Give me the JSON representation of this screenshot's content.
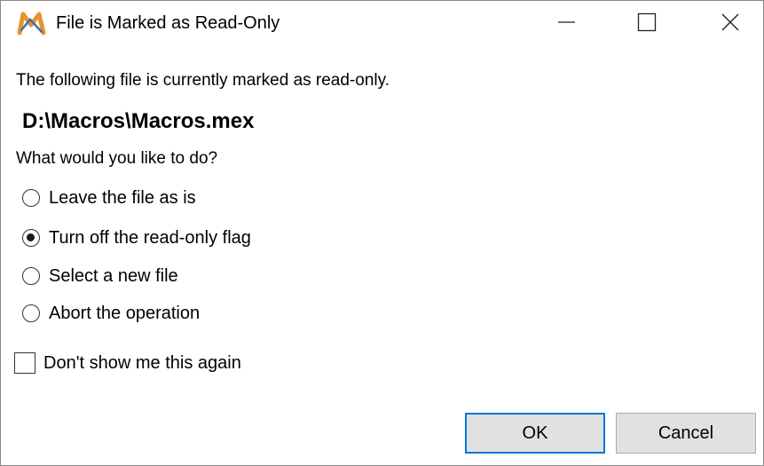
{
  "window": {
    "title": "File is Marked as Read-Only",
    "app_icon": "macro-express-m-icon",
    "controls": {
      "minimize_icon": "minimize-icon",
      "maximize_icon": "maximize-icon",
      "close_icon": "close-icon"
    }
  },
  "body": {
    "intro": "The following file is currently marked as read-only.",
    "file_path": "D:\\Macros\\Macros.mex",
    "question": "What would you like to do?",
    "options": [
      {
        "label": "Leave the file as is",
        "checked": false
      },
      {
        "label": "Turn off the read-only flag",
        "checked": true
      },
      {
        "label": "Select a new file",
        "checked": false
      },
      {
        "label": "Abort the operation",
        "checked": false
      }
    ],
    "dont_show": {
      "label": "Don't show me this again",
      "checked": false
    }
  },
  "buttons": {
    "ok": "OK",
    "cancel": "Cancel"
  },
  "colors": {
    "accent": "#0078d7",
    "button_face": "#e1e1e1",
    "icon_orange": "#e8932a",
    "icon_blue": "#3b6fb6"
  }
}
